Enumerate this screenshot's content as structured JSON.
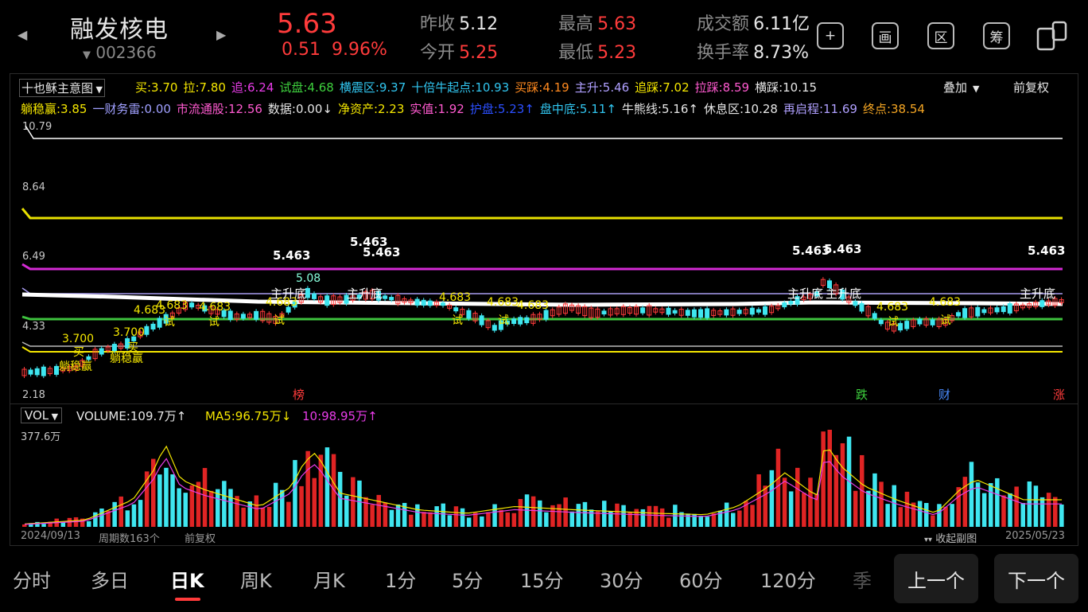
{
  "header": {
    "stock_name": "融发核电",
    "stock_code": "002366",
    "price": "5.63",
    "change": "0.51",
    "change_pct": "9.96%",
    "stats": [
      {
        "label": "昨收",
        "value": "5.12"
      },
      {
        "label": "今开",
        "value": "5.25"
      },
      {
        "label": "最高",
        "value": "5.63"
      },
      {
        "label": "最低",
        "value": "5.23"
      },
      {
        "label": "成交额",
        "value": "6.11亿"
      },
      {
        "label": "换手率",
        "value": "8.73%"
      }
    ],
    "tools": [
      {
        "name": "add",
        "label": "+"
      },
      {
        "name": "draw",
        "label": "画"
      },
      {
        "name": "interval",
        "label": "区"
      },
      {
        "name": "chips",
        "label": "筹"
      },
      {
        "name": "screen",
        "label": ""
      }
    ]
  },
  "chart_header": {
    "indicator_name": "十也稣主意图",
    "overlay": "叠加",
    "adjust": "前复权",
    "row1": [
      {
        "text": "买:3.70",
        "color": "#f5e700"
      },
      {
        "text": "拉:7.80",
        "color": "#f5e700"
      },
      {
        "text": "追:6.24",
        "color": "#e83ce8"
      },
      {
        "text": "试盘:4.68",
        "color": "#3ed13e"
      },
      {
        "text": "横震区:9.37",
        "color": "#31c6f0"
      },
      {
        "text": "十倍牛起点:10.93",
        "color": "#31c6f0"
      },
      {
        "text": "买踩:4.19",
        "color": "#ff8a1f"
      },
      {
        "text": "主升:5.46",
        "color": "#b0a0ff"
      },
      {
        "text": "追踩:7.02",
        "color": "#f5e700"
      },
      {
        "text": "拉踩:8.59",
        "color": "#ff5ad0"
      },
      {
        "text": "横踩:10.15",
        "color": "#e6e6e6"
      }
    ],
    "row2": [
      {
        "text": "躺稳赢:3.85",
        "color": "#f5e700"
      },
      {
        "text": "一财务雷:0.00",
        "color": "#a0a0ff"
      },
      {
        "text": "市流通股:12.56",
        "color": "#ff5ad0"
      },
      {
        "text": "数据:0.00↓",
        "color": "#e6e6e6"
      },
      {
        "text": "净资产:2.23",
        "color": "#f5e700"
      },
      {
        "text": "实值:1.92",
        "color": "#ff5ad0"
      },
      {
        "text": "护盘:5.23↑",
        "color": "#2b4fff"
      },
      {
        "text": "盘中底:5.11↑",
        "color": "#31c6f0"
      },
      {
        "text": "牛熊线:5.16↑",
        "color": "#e6e6e6"
      },
      {
        "text": "休息区:10.28",
        "color": "#e6e6e6"
      },
      {
        "text": "再启程:11.69",
        "color": "#b0a0ff"
      },
      {
        "text": "终点:38.54",
        "color": "#f5a623"
      }
    ]
  },
  "price_axis": [
    "10.79",
    "8.64",
    "6.49",
    "4.33",
    "2.18"
  ],
  "annotations": {
    "peak_labels": [
      "5.463",
      "5.463",
      "5.463",
      "5.463",
      "5.463",
      "5.463"
    ],
    "main_rise": [
      "主升底",
      "主升底",
      "主升底",
      "主升底",
      "主升底"
    ],
    "tries": [
      "4.683",
      "4.683",
      "4.683",
      "4.683",
      "4.683",
      "4.683",
      "4.683",
      "4.683",
      "4.683"
    ],
    "try_char": "试",
    "buy_labels": [
      "3.700",
      "3.700"
    ],
    "buy_char": "买",
    "steady": [
      "躺稳赢",
      "躺稳赢"
    ],
    "mid_value": "5.08",
    "events": [
      {
        "text": "榜",
        "color": "#ff3b3b"
      },
      {
        "text": "跌",
        "color": "#3ed13e"
      },
      {
        "text": "财",
        "color": "#4a8cff"
      },
      {
        "text": "涨",
        "color": "#ff3b3b"
      }
    ]
  },
  "volume_header": {
    "name": "VOL",
    "volume": "VOLUME:109.7万↑",
    "ma5": "MA5:96.75万↓",
    "ma10": "10:98.95万↑",
    "max_label": "377.6万"
  },
  "footer": {
    "start_date": "2024/09/13",
    "period_count": "周期数163个",
    "adjust": "前复权",
    "collapse": "收起副图",
    "end_date": "2025/05/23"
  },
  "timeframes": [
    "分时",
    "多日",
    "日K",
    "周K",
    "月K",
    "1分",
    "5分",
    "15分",
    "30分",
    "60分",
    "120分",
    "季"
  ],
  "active_timeframe": "日K",
  "nav": {
    "prev": "上一个",
    "next": "下一个"
  },
  "chart_data": {
    "type": "candlestick",
    "ylim": [
      2.18,
      10.79
    ],
    "volume_max": 377.6,
    "levels": [
      {
        "name": "白线",
        "value": 10.79,
        "color": "#ffffff"
      },
      {
        "name": "黄线",
        "value": 7.35,
        "color": "#f5e700"
      },
      {
        "name": "紫线",
        "value": 6.24,
        "color": "#e83ce8"
      },
      {
        "name": "试盘",
        "value": 4.68,
        "color": "#3ed13e"
      },
      {
        "name": "主升",
        "value": 5.46,
        "color": "#b0a0ff"
      }
    ]
  }
}
